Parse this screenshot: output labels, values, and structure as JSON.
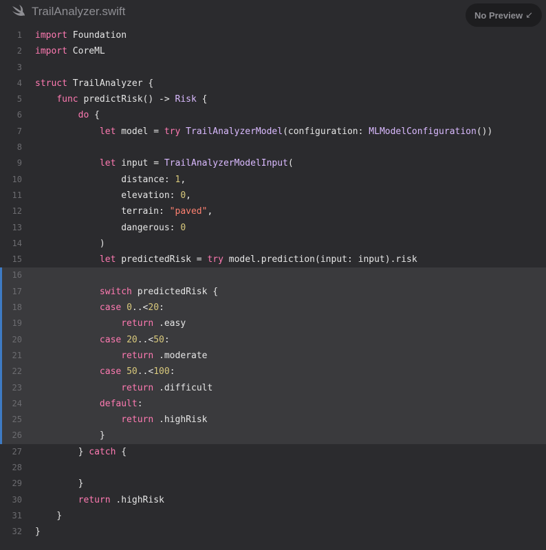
{
  "header": {
    "file_name": "TrailAnalyzer.swift",
    "preview_label": "No Preview",
    "preview_icon": "arrow-down-left-icon"
  },
  "colors": {
    "background": "#2b2b2e",
    "keyword": "#ff7ab2",
    "type": "#dabaff",
    "number": "#d9c97c",
    "string": "#ff8170",
    "highlight_bar": "#3e7bc4"
  },
  "code": {
    "highlighted_lines": [
      16,
      26
    ],
    "lines": [
      {
        "n": "1",
        "tokens": [
          {
            "c": "k",
            "v": "import"
          },
          {
            "c": "p",
            "v": " Foundation"
          }
        ]
      },
      {
        "n": "2",
        "tokens": [
          {
            "c": "k",
            "v": "import"
          },
          {
            "c": "p",
            "v": " CoreML"
          }
        ]
      },
      {
        "n": "3",
        "tokens": []
      },
      {
        "n": "4",
        "tokens": [
          {
            "c": "k",
            "v": "struct"
          },
          {
            "c": "p",
            "v": " TrailAnalyzer {"
          }
        ]
      },
      {
        "n": "5",
        "tokens": [
          {
            "c": "p",
            "v": "    "
          },
          {
            "c": "k",
            "v": "func"
          },
          {
            "c": "p",
            "v": " predictRisk() -> "
          },
          {
            "c": "t",
            "v": "Risk"
          },
          {
            "c": "p",
            "v": " {"
          }
        ]
      },
      {
        "n": "6",
        "tokens": [
          {
            "c": "p",
            "v": "        "
          },
          {
            "c": "k",
            "v": "do"
          },
          {
            "c": "p",
            "v": " {"
          }
        ]
      },
      {
        "n": "7",
        "tokens": [
          {
            "c": "p",
            "v": "            "
          },
          {
            "c": "k",
            "v": "let"
          },
          {
            "c": "p",
            "v": " model = "
          },
          {
            "c": "k",
            "v": "try"
          },
          {
            "c": "p",
            "v": " "
          },
          {
            "c": "t",
            "v": "TrailAnalyzerModel"
          },
          {
            "c": "p",
            "v": "(configuration: "
          },
          {
            "c": "t",
            "v": "MLModelConfiguration"
          },
          {
            "c": "p",
            "v": "())"
          }
        ]
      },
      {
        "n": "8",
        "tokens": []
      },
      {
        "n": "9",
        "tokens": [
          {
            "c": "p",
            "v": "            "
          },
          {
            "c": "k",
            "v": "let"
          },
          {
            "c": "p",
            "v": " input = "
          },
          {
            "c": "t",
            "v": "TrailAnalyzerModelInput"
          },
          {
            "c": "p",
            "v": "("
          }
        ]
      },
      {
        "n": "10",
        "tokens": [
          {
            "c": "p",
            "v": "                distance: "
          },
          {
            "c": "n",
            "v": "1"
          },
          {
            "c": "p",
            "v": ","
          }
        ]
      },
      {
        "n": "11",
        "tokens": [
          {
            "c": "p",
            "v": "                elevation: "
          },
          {
            "c": "n",
            "v": "0"
          },
          {
            "c": "p",
            "v": ","
          }
        ]
      },
      {
        "n": "12",
        "tokens": [
          {
            "c": "p",
            "v": "                terrain: "
          },
          {
            "c": "s",
            "v": "\"paved\""
          },
          {
            "c": "p",
            "v": ","
          }
        ]
      },
      {
        "n": "13",
        "tokens": [
          {
            "c": "p",
            "v": "                dangerous: "
          },
          {
            "c": "n",
            "v": "0"
          }
        ]
      },
      {
        "n": "14",
        "tokens": [
          {
            "c": "p",
            "v": "            )"
          }
        ]
      },
      {
        "n": "15",
        "tokens": [
          {
            "c": "p",
            "v": "            "
          },
          {
            "c": "k",
            "v": "let"
          },
          {
            "c": "p",
            "v": " predictedRisk = "
          },
          {
            "c": "k",
            "v": "try"
          },
          {
            "c": "p",
            "v": " model.prediction(input: input).risk"
          }
        ]
      },
      {
        "n": "16",
        "tokens": []
      },
      {
        "n": "17",
        "tokens": [
          {
            "c": "p",
            "v": "            "
          },
          {
            "c": "k",
            "v": "switch"
          },
          {
            "c": "p",
            "v": " predictedRisk {"
          }
        ]
      },
      {
        "n": "18",
        "tokens": [
          {
            "c": "p",
            "v": "            "
          },
          {
            "c": "k",
            "v": "case"
          },
          {
            "c": "p",
            "v": " "
          },
          {
            "c": "n",
            "v": "0"
          },
          {
            "c": "p",
            "v": "..<"
          },
          {
            "c": "n",
            "v": "20"
          },
          {
            "c": "p",
            "v": ":"
          }
        ]
      },
      {
        "n": "19",
        "tokens": [
          {
            "c": "p",
            "v": "                "
          },
          {
            "c": "k",
            "v": "return"
          },
          {
            "c": "p",
            "v": " .easy"
          }
        ]
      },
      {
        "n": "20",
        "tokens": [
          {
            "c": "p",
            "v": "            "
          },
          {
            "c": "k",
            "v": "case"
          },
          {
            "c": "p",
            "v": " "
          },
          {
            "c": "n",
            "v": "20"
          },
          {
            "c": "p",
            "v": "..<"
          },
          {
            "c": "n",
            "v": "50"
          },
          {
            "c": "p",
            "v": ":"
          }
        ]
      },
      {
        "n": "21",
        "tokens": [
          {
            "c": "p",
            "v": "                "
          },
          {
            "c": "k",
            "v": "return"
          },
          {
            "c": "p",
            "v": " .moderate"
          }
        ]
      },
      {
        "n": "22",
        "tokens": [
          {
            "c": "p",
            "v": "            "
          },
          {
            "c": "k",
            "v": "case"
          },
          {
            "c": "p",
            "v": " "
          },
          {
            "c": "n",
            "v": "50"
          },
          {
            "c": "p",
            "v": "..<"
          },
          {
            "c": "n",
            "v": "100"
          },
          {
            "c": "p",
            "v": ":"
          }
        ]
      },
      {
        "n": "23",
        "tokens": [
          {
            "c": "p",
            "v": "                "
          },
          {
            "c": "k",
            "v": "return"
          },
          {
            "c": "p",
            "v": " .difficult"
          }
        ]
      },
      {
        "n": "24",
        "tokens": [
          {
            "c": "p",
            "v": "            "
          },
          {
            "c": "k",
            "v": "default"
          },
          {
            "c": "p",
            "v": ":"
          }
        ]
      },
      {
        "n": "25",
        "tokens": [
          {
            "c": "p",
            "v": "                "
          },
          {
            "c": "k",
            "v": "return"
          },
          {
            "c": "p",
            "v": " .highRisk"
          }
        ]
      },
      {
        "n": "26",
        "tokens": [
          {
            "c": "p",
            "v": "            }"
          }
        ]
      },
      {
        "n": "27",
        "tokens": [
          {
            "c": "p",
            "v": "        } "
          },
          {
            "c": "k",
            "v": "catch"
          },
          {
            "c": "p",
            "v": " {"
          }
        ]
      },
      {
        "n": "28",
        "tokens": []
      },
      {
        "n": "29",
        "tokens": [
          {
            "c": "p",
            "v": "        }"
          }
        ]
      },
      {
        "n": "30",
        "tokens": [
          {
            "c": "p",
            "v": "        "
          },
          {
            "c": "k",
            "v": "return"
          },
          {
            "c": "p",
            "v": " .highRisk"
          }
        ]
      },
      {
        "n": "31",
        "tokens": [
          {
            "c": "p",
            "v": "    }"
          }
        ]
      },
      {
        "n": "32",
        "tokens": [
          {
            "c": "p",
            "v": "}"
          }
        ]
      }
    ]
  }
}
